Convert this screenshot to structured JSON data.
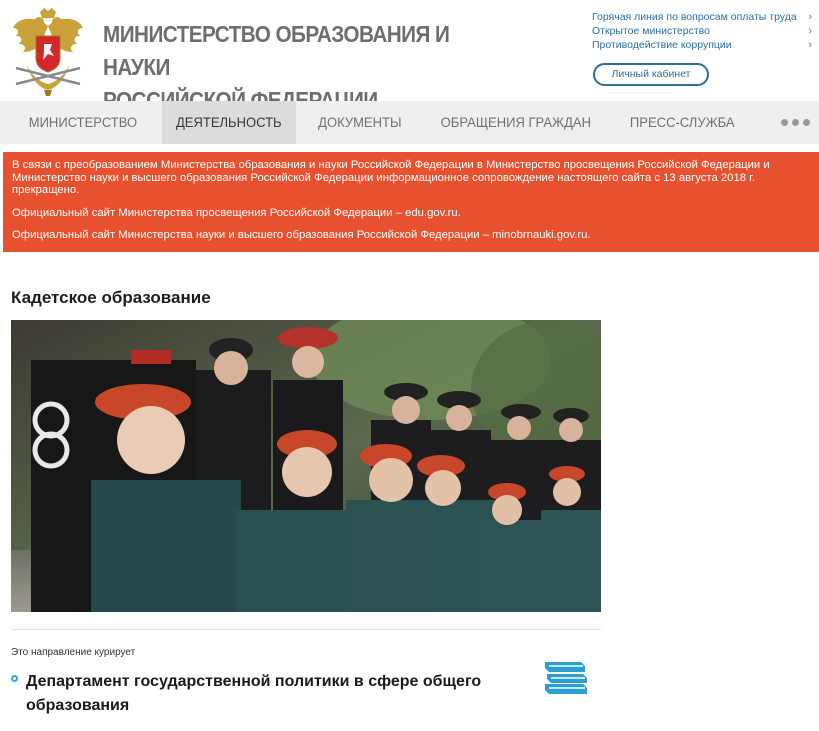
{
  "header": {
    "title_line1": "Министерство образования и науки",
    "title_line2": "Российской Федерации",
    "top_links": [
      {
        "label": "Горячая линия по вопросам оплаты труда"
      },
      {
        "label": "Открытое министерство"
      },
      {
        "label": "Противодействие коррупции"
      }
    ],
    "chevron": "›",
    "cabinet_label": "Личный кабинет"
  },
  "nav": {
    "items": [
      {
        "label": "Министерство",
        "active": false
      },
      {
        "label": "Деятельность",
        "active": true
      },
      {
        "label": "Документы",
        "active": false
      },
      {
        "label": "Обращения граждан",
        "active": false
      },
      {
        "label": "Пресс-служба",
        "active": false
      }
    ],
    "more_icon": "more-dots-icon"
  },
  "alert": {
    "line1": "В связи с преобразованием Министерства образования и науки Российской Федерации в Министерство просвещения Российской Федерации и Министерство науки и высшего образования Российской Федерации информационное сопровождение настоящего сайта с 13 августа 2018 г. прекращено.",
    "line2": "Официальный сайт Министерства просвещения Российской Федерации – edu.gov.ru.",
    "line3": "Официальный сайт Министерства науки и высшего образования Российской Федерации – minobrnauki.gov.ru.",
    "color": "#e8512f"
  },
  "main": {
    "title": "Кадетское образование",
    "photo_icon": "cadets-photo",
    "curator_label": "Это направление курирует",
    "department": "Департамент государственной политики в сфере общего образования",
    "department_icon": "books-icon"
  },
  "colors": {
    "accent_blue": "#2a6ea8",
    "bullet": "#2aa9d6",
    "books": "#2a9fd3",
    "nav_bg": "#efefef",
    "nav_active": "#dcdcdc"
  }
}
